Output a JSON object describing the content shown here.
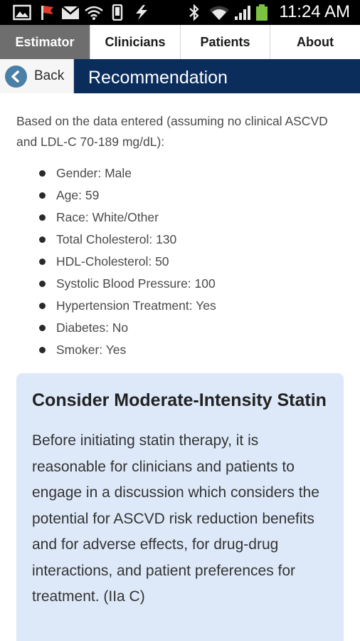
{
  "status_bar": {
    "time": "11:24 AM",
    "icons": [
      "gallery-icon",
      "flag-icon",
      "gmail-icon",
      "wifi-hotspot-icon",
      "phone-icon",
      "flash-icon",
      "bluetooth-icon",
      "wifi-icon",
      "signal-icon",
      "battery-icon"
    ],
    "battery_color": "#7bc142"
  },
  "tabs": [
    {
      "label": "Estimator",
      "active": true
    },
    {
      "label": "Clinicians",
      "active": false
    },
    {
      "label": "Patients",
      "active": false
    },
    {
      "label": "About",
      "active": false
    }
  ],
  "header": {
    "back_label": "Back",
    "title": "Recommendation",
    "color": "#0b2d5c"
  },
  "intro": "Based on the data entered (assuming no clinical ASCVD and LDL-C 70-189 mg/dL):",
  "inputs": [
    "Gender: Male",
    "Age: 59",
    "Race: White/Other",
    "Total Cholesterol: 130",
    "HDL-Cholesterol: 50",
    "Systolic Blood Pressure: 100",
    "Hypertension Treatment: Yes",
    "Diabetes: No",
    "Smoker: Yes"
  ],
  "recommendation": {
    "title": "Consider Moderate-Intensity Statin",
    "body": "Before initiating statin therapy, it is reasonable for clinicians and patients to engage in a discussion which considers the potential for ASCVD risk reduction benefits and for adverse effects, for drug-drug interactions, and patient preferences for treatment. (IIa C)",
    "background": "#dde9f9"
  }
}
